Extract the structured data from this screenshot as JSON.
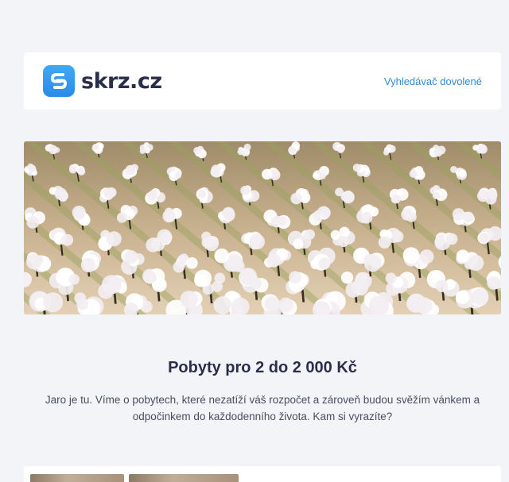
{
  "header": {
    "logo_text": "skrz.cz",
    "nav_link": "Vyhledávač dovolené",
    "brand_color": "#2e8ad8"
  },
  "hero": {
    "image": "almond-orchard-blossom-photo"
  },
  "content": {
    "title": "Pobyty pro 2 do 2 000 Kč",
    "description": "Jaro je tu. Víme o pobytech, které nezatíží váš rozpočet a zároveň budou svěžím vánkem a odpočinkem do každodenního života. Kam si vyrazíte?"
  },
  "icons": {
    "logo": "skrz-s-logo-icon"
  }
}
